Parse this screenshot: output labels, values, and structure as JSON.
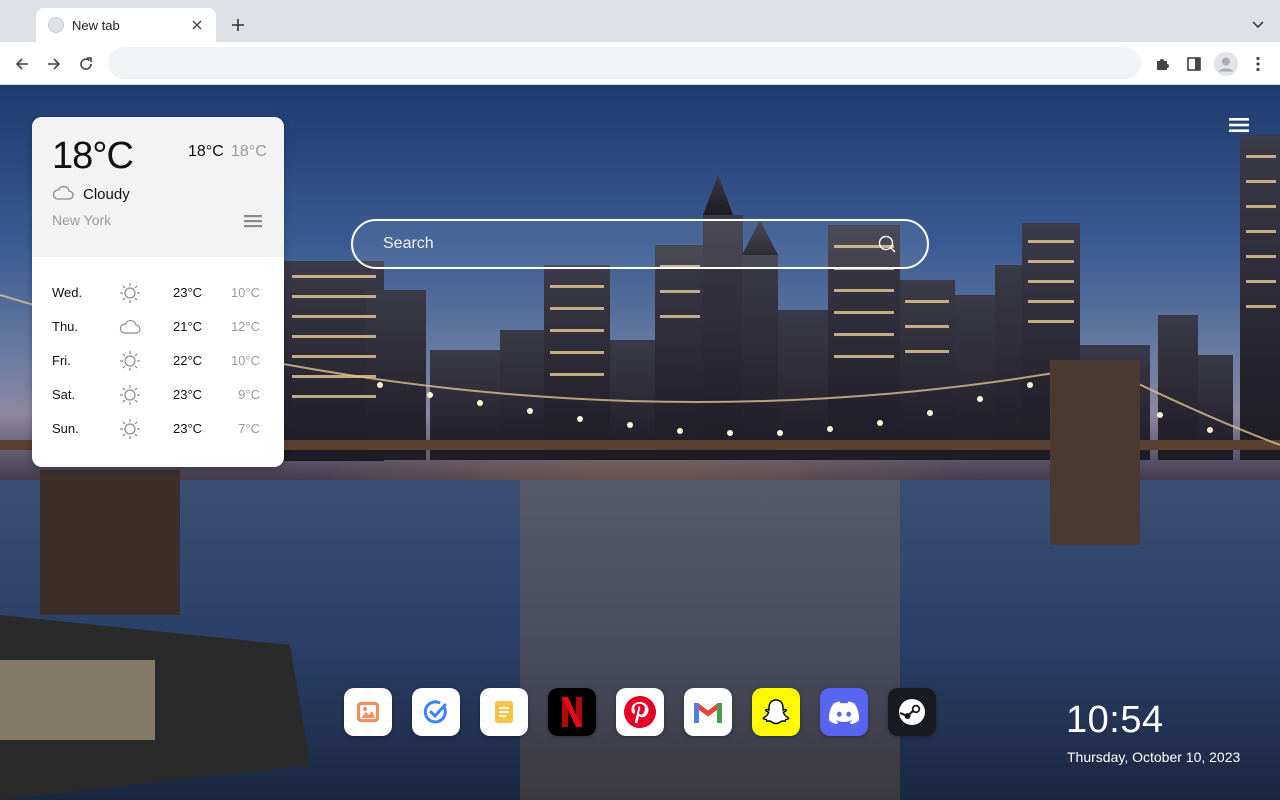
{
  "browser": {
    "tab": {
      "title": "New tab",
      "favicon": "globe-icon",
      "close_icon": "close-icon"
    },
    "new_tab_icon": "plus-icon",
    "tab_search_icon": "chevron-down-icon",
    "toolbar": {
      "back_icon": "arrow-left-icon",
      "forward_icon": "arrow-right-icon",
      "reload_icon": "reload-icon",
      "omnibox_value": "",
      "extensions_icon": "puzzle-icon",
      "side_panel_icon": "side-panel-icon",
      "profile_icon": "avatar-icon",
      "menu_icon": "kebab-menu-icon"
    }
  },
  "weather": {
    "current_temp": "18°C",
    "high": "18°C",
    "low": "18°C",
    "condition": "Cloudy",
    "condition_icon": "cloud-icon",
    "city": "New York",
    "menu_icon": "hamburger-icon",
    "forecast": [
      {
        "day": "Wed.",
        "icon": "sun-icon",
        "high": "23°C",
        "low": "10°C"
      },
      {
        "day": "Thu.",
        "icon": "cloud-icon",
        "high": "21°C",
        "low": "12°C"
      },
      {
        "day": "Fri.",
        "icon": "sun-icon",
        "high": "22°C",
        "low": "10°C"
      },
      {
        "day": "Sat.",
        "icon": "sun-icon",
        "high": "23°C",
        "low": "9°C"
      },
      {
        "day": "Sun.",
        "icon": "sun-icon",
        "high": "23°C",
        "low": "7°C"
      }
    ]
  },
  "search": {
    "placeholder": "Search",
    "icon": "search-icon"
  },
  "page_menu_icon": "hamburger-icon",
  "dock": [
    {
      "name": "wallpaper",
      "icon": "image-icon"
    },
    {
      "name": "todo",
      "icon": "check-circle-icon"
    },
    {
      "name": "notes",
      "icon": "note-icon"
    },
    {
      "name": "netflix",
      "icon": "netflix-icon"
    },
    {
      "name": "pinterest",
      "icon": "pinterest-icon"
    },
    {
      "name": "gmail",
      "icon": "gmail-icon"
    },
    {
      "name": "snapchat",
      "icon": "snapchat-icon"
    },
    {
      "name": "discord",
      "icon": "discord-icon"
    },
    {
      "name": "steam",
      "icon": "steam-icon"
    }
  ],
  "clock": {
    "time": "10:54",
    "date": "Thursday, October 10, 2023"
  },
  "colors": {
    "netflix": "#e50914",
    "pinterest": "#e60023",
    "snapchat": "#fffc00",
    "discord": "#5865f2",
    "steam": "#171a21"
  }
}
